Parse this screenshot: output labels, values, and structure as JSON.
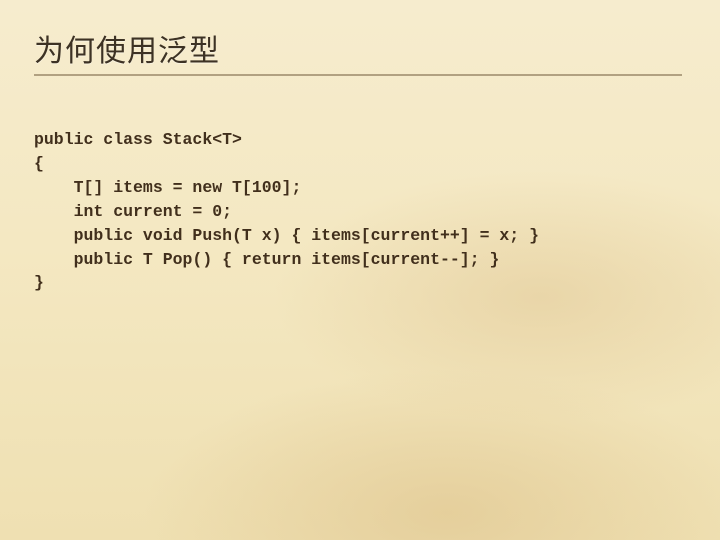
{
  "title": "为何使用泛型",
  "code": {
    "line1": "public class Stack<T>",
    "line2": "{",
    "line3": "    T[] items = new T[100];",
    "line4": "    int current = 0;",
    "line5": "    public void Push(T x) { items[current++] = x; }",
    "line6": "    public T Pop() { return items[current--]; }",
    "line7": "}"
  }
}
